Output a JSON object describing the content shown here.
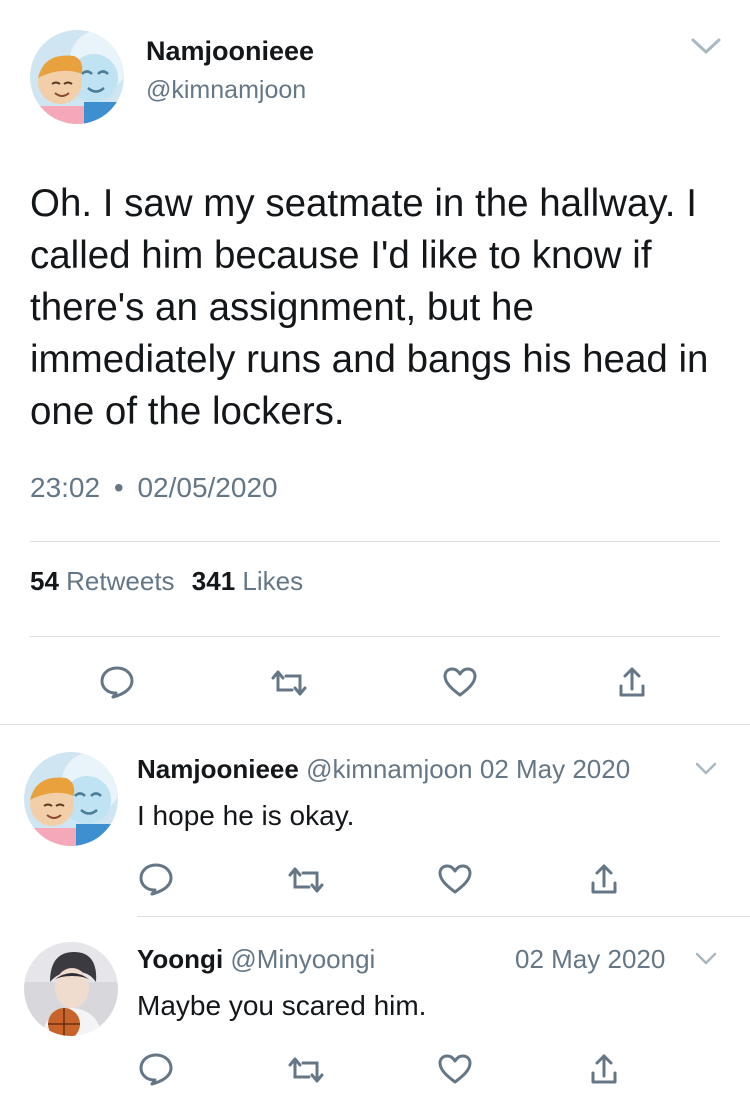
{
  "main_tweet": {
    "display_name": "Namjoonieee",
    "handle": "@kimnamjoon",
    "text": "Oh. I saw my seatmate in the hallway. I called him because I'd like to know if there's an assignment, but he immediately runs and bangs his head in one of the lockers.",
    "time": "23:02",
    "separator": "•",
    "date": "02/05/2020",
    "retweets_count": "54",
    "retweets_label": "Retweets",
    "likes_count": "341",
    "likes_label": "Likes"
  },
  "replies": [
    {
      "display_name": "Namjoonieee",
      "handle": "@kimnamjoon",
      "date": "02 May 2020",
      "text": "I hope he is okay."
    },
    {
      "display_name": "Yoongi",
      "handle": "@Minyoongi",
      "date": "02 May 2020",
      "text": "Maybe you scared him."
    }
  ],
  "icons": {
    "reply": "speech-bubble-icon",
    "retweet": "retweet-icon",
    "like": "heart-icon",
    "share": "share-icon",
    "menu": "chevron-down-icon"
  },
  "colors": {
    "text": "#14171a",
    "muted": "#657786",
    "divider": "#d9dfe4"
  }
}
